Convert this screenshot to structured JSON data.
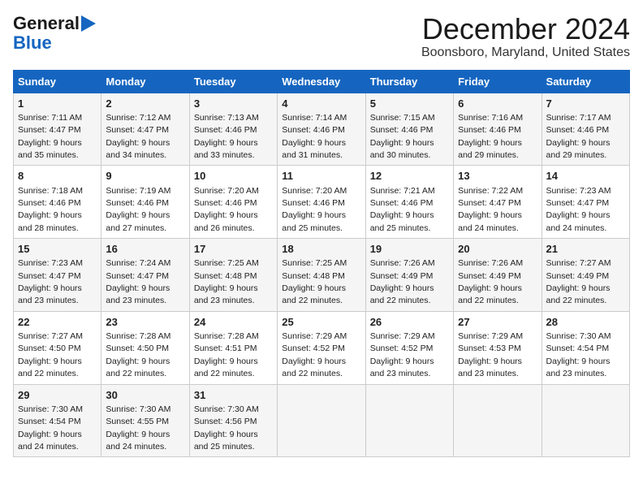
{
  "logo": {
    "line1": "General",
    "line2": "Blue"
  },
  "title": "December 2024",
  "subtitle": "Boonsboro, Maryland, United States",
  "days_of_week": [
    "Sunday",
    "Monday",
    "Tuesday",
    "Wednesday",
    "Thursday",
    "Friday",
    "Saturday"
  ],
  "weeks": [
    [
      {
        "day": "1",
        "sunrise": "7:11 AM",
        "sunset": "4:47 PM",
        "daylight": "9 hours and 35 minutes."
      },
      {
        "day": "2",
        "sunrise": "7:12 AM",
        "sunset": "4:47 PM",
        "daylight": "9 hours and 34 minutes."
      },
      {
        "day": "3",
        "sunrise": "7:13 AM",
        "sunset": "4:46 PM",
        "daylight": "9 hours and 33 minutes."
      },
      {
        "day": "4",
        "sunrise": "7:14 AM",
        "sunset": "4:46 PM",
        "daylight": "9 hours and 31 minutes."
      },
      {
        "day": "5",
        "sunrise": "7:15 AM",
        "sunset": "4:46 PM",
        "daylight": "9 hours and 30 minutes."
      },
      {
        "day": "6",
        "sunrise": "7:16 AM",
        "sunset": "4:46 PM",
        "daylight": "9 hours and 29 minutes."
      },
      {
        "day": "7",
        "sunrise": "7:17 AM",
        "sunset": "4:46 PM",
        "daylight": "9 hours and 29 minutes."
      }
    ],
    [
      {
        "day": "8",
        "sunrise": "7:18 AM",
        "sunset": "4:46 PM",
        "daylight": "9 hours and 28 minutes."
      },
      {
        "day": "9",
        "sunrise": "7:19 AM",
        "sunset": "4:46 PM",
        "daylight": "9 hours and 27 minutes."
      },
      {
        "day": "10",
        "sunrise": "7:20 AM",
        "sunset": "4:46 PM",
        "daylight": "9 hours and 26 minutes."
      },
      {
        "day": "11",
        "sunrise": "7:20 AM",
        "sunset": "4:46 PM",
        "daylight": "9 hours and 25 minutes."
      },
      {
        "day": "12",
        "sunrise": "7:21 AM",
        "sunset": "4:46 PM",
        "daylight": "9 hours and 25 minutes."
      },
      {
        "day": "13",
        "sunrise": "7:22 AM",
        "sunset": "4:47 PM",
        "daylight": "9 hours and 24 minutes."
      },
      {
        "day": "14",
        "sunrise": "7:23 AM",
        "sunset": "4:47 PM",
        "daylight": "9 hours and 24 minutes."
      }
    ],
    [
      {
        "day": "15",
        "sunrise": "7:23 AM",
        "sunset": "4:47 PM",
        "daylight": "9 hours and 23 minutes."
      },
      {
        "day": "16",
        "sunrise": "7:24 AM",
        "sunset": "4:47 PM",
        "daylight": "9 hours and 23 minutes."
      },
      {
        "day": "17",
        "sunrise": "7:25 AM",
        "sunset": "4:48 PM",
        "daylight": "9 hours and 23 minutes."
      },
      {
        "day": "18",
        "sunrise": "7:25 AM",
        "sunset": "4:48 PM",
        "daylight": "9 hours and 22 minutes."
      },
      {
        "day": "19",
        "sunrise": "7:26 AM",
        "sunset": "4:49 PM",
        "daylight": "9 hours and 22 minutes."
      },
      {
        "day": "20",
        "sunrise": "7:26 AM",
        "sunset": "4:49 PM",
        "daylight": "9 hours and 22 minutes."
      },
      {
        "day": "21",
        "sunrise": "7:27 AM",
        "sunset": "4:49 PM",
        "daylight": "9 hours and 22 minutes."
      }
    ],
    [
      {
        "day": "22",
        "sunrise": "7:27 AM",
        "sunset": "4:50 PM",
        "daylight": "9 hours and 22 minutes."
      },
      {
        "day": "23",
        "sunrise": "7:28 AM",
        "sunset": "4:50 PM",
        "daylight": "9 hours and 22 minutes."
      },
      {
        "day": "24",
        "sunrise": "7:28 AM",
        "sunset": "4:51 PM",
        "daylight": "9 hours and 22 minutes."
      },
      {
        "day": "25",
        "sunrise": "7:29 AM",
        "sunset": "4:52 PM",
        "daylight": "9 hours and 22 minutes."
      },
      {
        "day": "26",
        "sunrise": "7:29 AM",
        "sunset": "4:52 PM",
        "daylight": "9 hours and 23 minutes."
      },
      {
        "day": "27",
        "sunrise": "7:29 AM",
        "sunset": "4:53 PM",
        "daylight": "9 hours and 23 minutes."
      },
      {
        "day": "28",
        "sunrise": "7:30 AM",
        "sunset": "4:54 PM",
        "daylight": "9 hours and 23 minutes."
      }
    ],
    [
      {
        "day": "29",
        "sunrise": "7:30 AM",
        "sunset": "4:54 PM",
        "daylight": "9 hours and 24 minutes."
      },
      {
        "day": "30",
        "sunrise": "7:30 AM",
        "sunset": "4:55 PM",
        "daylight": "9 hours and 24 minutes."
      },
      {
        "day": "31",
        "sunrise": "7:30 AM",
        "sunset": "4:56 PM",
        "daylight": "9 hours and 25 minutes."
      },
      null,
      null,
      null,
      null
    ]
  ],
  "labels": {
    "sunrise": "Sunrise:",
    "sunset": "Sunset:",
    "daylight": "Daylight:"
  }
}
